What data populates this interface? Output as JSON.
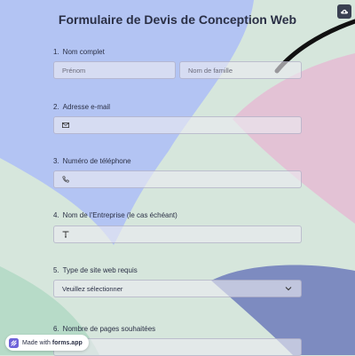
{
  "form": {
    "title": "Formulaire de Devis de Conception Web",
    "save_icon": "cloud-save-icon"
  },
  "questions": [
    {
      "number": "1.",
      "label": "Nom complet",
      "fields": [
        {
          "placeholder": "Prénom"
        },
        {
          "placeholder": "Nom de famille"
        }
      ]
    },
    {
      "number": "2.",
      "label": "Adresse e-mail",
      "icon": "mail-icon"
    },
    {
      "number": "3.",
      "label": "Numéro de téléphone",
      "icon": "phone-icon"
    },
    {
      "number": "4.",
      "label": "Nom de l'Entreprise (le cas échéant)",
      "icon": "text-icon"
    },
    {
      "number": "5.",
      "label": "Type de site web requis",
      "select_value": "Veuillez sélectionner",
      "icon": "chevron-down-icon"
    },
    {
      "number": "6.",
      "label": "Nombre de pages souhaitées"
    }
  ],
  "badge": {
    "prefix": "Made with",
    "brand": "forms.app",
    "icon": "forms-app-logo-icon"
  },
  "colors": {
    "background": "#d6e6dc",
    "blue_shape": "#b3c4f3",
    "pink_shape": "#e3c2d5",
    "navy_shape": "#7d8bc0",
    "green_shape": "#b7dbc8"
  }
}
